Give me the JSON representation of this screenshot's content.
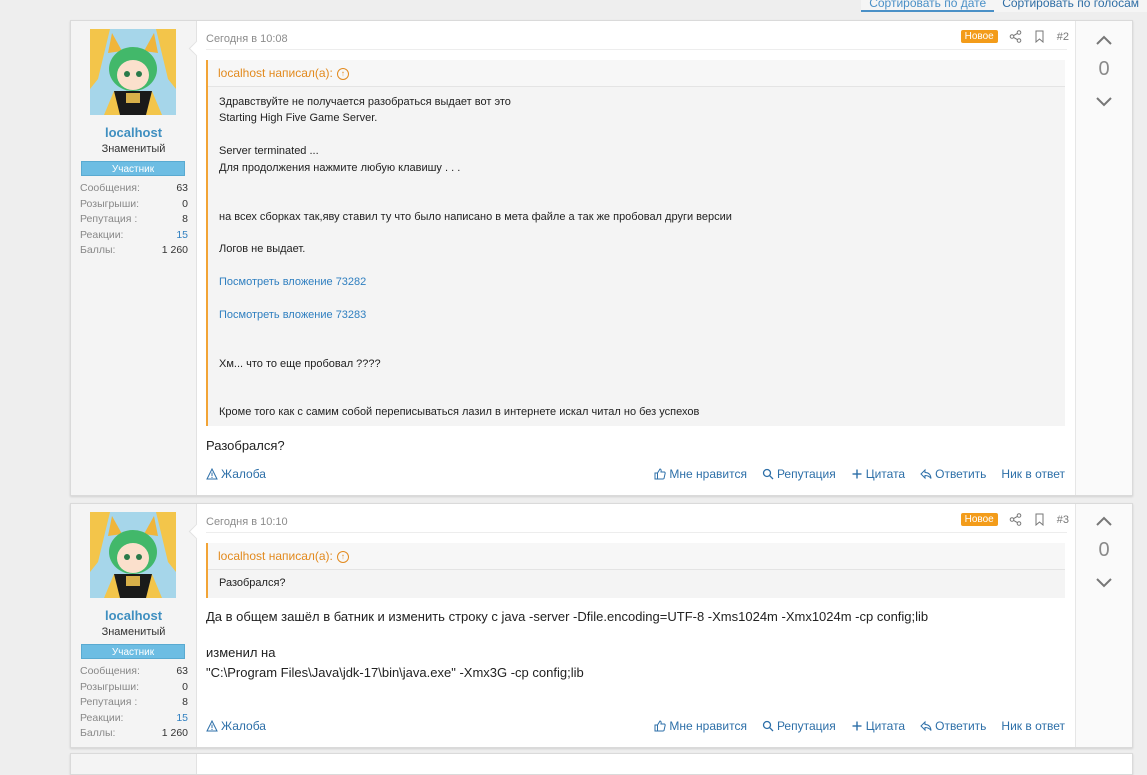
{
  "sort_tabs": [
    "Сортировать по дате",
    "Сортировать по голосам"
  ],
  "posts": [
    {
      "user": {
        "name": "localhost",
        "title": "Знаменитый",
        "badge": "Участник",
        "stats": [
          {
            "label": "Сообщения:",
            "value": "63"
          },
          {
            "label": "Розыгрыши:",
            "value": "0"
          },
          {
            "label": "Репутация :",
            "value": "8"
          },
          {
            "label": "Реакции:",
            "value": "15"
          },
          {
            "label": "Баллы:",
            "value": "1 260"
          }
        ]
      },
      "date": "Сегодня в 10:08",
      "new_badge": "Новое",
      "number": "#2",
      "quote": {
        "author": "localhost написал(а):",
        "lines": [
          "Здравствуйте не получается разобраться выдает вот это",
          "Starting High Five Game Server.",
          "Server terminated ...",
          "Для продолжения нажмите любую клавишу . . .",
          "на всех сборках так,яву ставил ту что было написано в мета файле а так же пробовал други версии",
          "Логов не выдает.",
          "Посмотреть вложение 73282",
          "Посмотреть вложение 73283",
          "Хм... что то еще пробовал ????",
          "Кроме того как с самим собой переписываться лазил в интернете искал читал но без успехов"
        ]
      },
      "body": [
        "Разобрался?"
      ],
      "votes": "0"
    },
    {
      "user": {
        "name": "localhost",
        "title": "Знаменитый",
        "badge": "Участник",
        "stats": [
          {
            "label": "Сообщения:",
            "value": "63"
          },
          {
            "label": "Розыгрыши:",
            "value": "0"
          },
          {
            "label": "Репутация :",
            "value": "8"
          },
          {
            "label": "Реакции:",
            "value": "15"
          },
          {
            "label": "Баллы:",
            "value": "1 260"
          }
        ]
      },
      "date": "Сегодня в 10:10",
      "new_badge": "Новое",
      "number": "#3",
      "quote": {
        "author": "localhost написал(а):",
        "lines": [
          "Разобрался?"
        ]
      },
      "body": [
        "Да в общем зашёл в батник и изменить строку с java -server -Dfile.encoding=UTF-8 -Xms1024m -Xmx1024m -cp config;lib",
        "изменил на",
        "\"C:\\Program Files\\Java\\jdk-17\\bin\\java.exe\" -Xmx3G -cp config;lib"
      ],
      "votes": "0"
    }
  ],
  "footer": {
    "report": "Жалоба",
    "like": "Мне нравится",
    "reputation": "Репутация",
    "quote": "Цитата",
    "reply": "Ответить",
    "nick_reply": "Ник в ответ"
  },
  "colors": {
    "accent": "#3f8fc0",
    "quote_border": "#f2a436",
    "new_badge": "#f39c1a",
    "member_badge": "#6dbde3"
  }
}
